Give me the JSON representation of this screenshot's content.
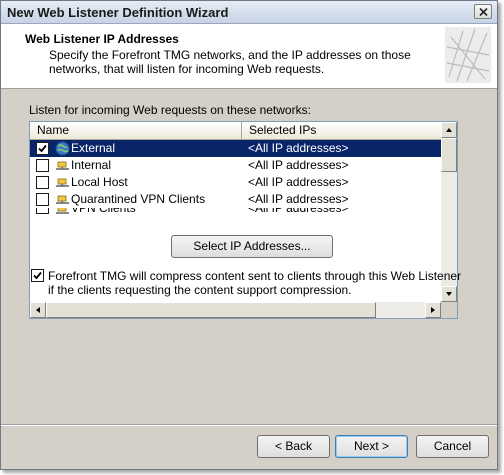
{
  "window": {
    "title": "New Web Listener Definition Wizard"
  },
  "header": {
    "title": "Web Listener IP Addresses",
    "description": "Specify the Forefront TMG networks, and the IP addresses on those networks, that will listen for incoming Web requests."
  },
  "networks": {
    "label": "Listen for incoming Web requests on these networks:",
    "columns": [
      "Name",
      "Selected IPs"
    ],
    "rows": [
      {
        "name": "External",
        "ips": "<All IP addresses>",
        "checked": true,
        "selected": true,
        "icon": "globe-icon"
      },
      {
        "name": "Internal",
        "ips": "<All IP addresses>",
        "checked": false,
        "selected": false,
        "icon": "network-icon"
      },
      {
        "name": "Local Host",
        "ips": "<All IP addresses>",
        "checked": false,
        "selected": false,
        "icon": "network-icon"
      },
      {
        "name": "Quarantined VPN Clients",
        "ips": "<All IP addresses>",
        "checked": false,
        "selected": false,
        "icon": "network-icon"
      },
      {
        "name": "VPN Clients",
        "ips": "<All IP addresses>",
        "checked": false,
        "selected": false,
        "icon": "network-icon"
      }
    ]
  },
  "select_button": "Select IP Addresses...",
  "compression": {
    "checked": true,
    "label": "Forefront TMG will compress content sent to clients through this Web Listener if the clients requesting the content support compression."
  },
  "footer": {
    "back": "< Back",
    "next": "Next >",
    "cancel": "Cancel"
  },
  "colors": {
    "selection": "#0a246a",
    "dialog_background": "#d4d0c8"
  }
}
